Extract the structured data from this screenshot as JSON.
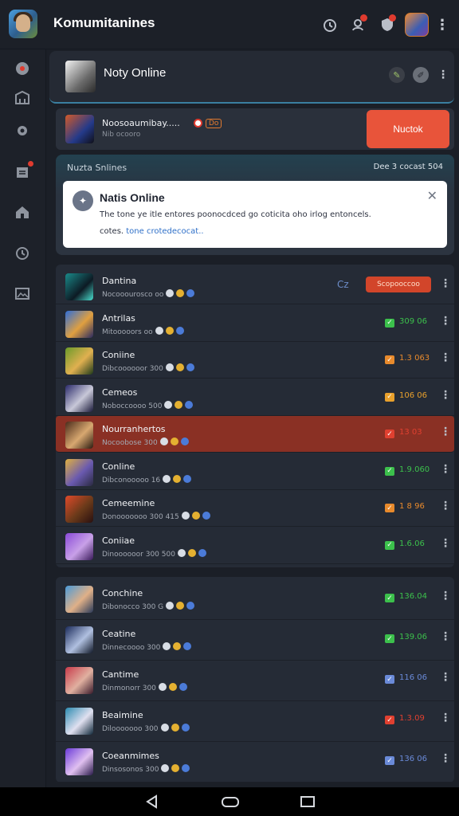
{
  "app": {
    "title": "Komumitanines"
  },
  "header": {
    "title": "Noty Online"
  },
  "request": {
    "name": "Noosoaumibay.....",
    "sub": "Nib ocooro",
    "chip": "Do",
    "button_label": "Nuctok"
  },
  "notice": {
    "section_label": "Nuzta Snlines",
    "date": "Dee 3 cocast 504",
    "title": "Natis Online",
    "body": "The tone ye itle entores poonocdced go coticita oho irlog entoncels.",
    "body2_prefix": "cotes.",
    "body2_link": "tone crotedecocat.."
  },
  "list1": [
    {
      "name": "Dantina",
      "sub": "Nocooourosco oo",
      "value": "",
      "badge": "Scopooccoo",
      "flag": "Cz",
      "status": "badge",
      "color": "#e03b2f"
    },
    {
      "name": "Antrilas",
      "sub": "Mitooooors oo",
      "value": "309 06",
      "status": "green",
      "color": "#3cc04c"
    },
    {
      "name": "Coniine",
      "sub": "Dibcoooooor 300",
      "value": "1.3 063",
      "status": "orange",
      "color": "#e88a2c"
    },
    {
      "name": "Cemeos",
      "sub": "Noboccoooo 500",
      "value": "106 06",
      "status": "orange",
      "color": "#e8a02c"
    },
    {
      "name": "Nourranhertos",
      "sub": "Nocoobose 300",
      "value": "13 03",
      "status": "red",
      "color": "#e04030",
      "highlight": true
    },
    {
      "name": "Conline",
      "sub": "Dibconooooo 16",
      "value": "1.9.060",
      "status": "green",
      "color": "#3cc04c"
    },
    {
      "name": "Cemeemine",
      "sub": "Donooooooo 300 415",
      "value": "1 8 96",
      "status": "orange",
      "color": "#e88a2c"
    },
    {
      "name": "Coniiae",
      "sub": "Dinoooooor 300 500",
      "value": "1.6.06",
      "status": "green",
      "color": "#3cc04c"
    }
  ],
  "list2": [
    {
      "name": "Conchine",
      "sub": "Dibonocco 300 G",
      "value": "136.04",
      "status": "green",
      "color": "#3cc04c"
    },
    {
      "name": "Ceatine",
      "sub": "Dinnecoooo 300",
      "value": "139.06",
      "status": "green",
      "color": "#3cc04c"
    },
    {
      "name": "Cantime",
      "sub": "Dinmonorr 300",
      "value": "116 06",
      "status": "blue",
      "color": "#6a8ad8"
    },
    {
      "name": "Beaimine",
      "sub": "Dilooooooo 300",
      "value": "1.3.09",
      "status": "red",
      "color": "#e04030"
    },
    {
      "name": "Coeanmimes",
      "sub": "Dinsosonos 300",
      "value": "136 06",
      "status": "blue",
      "color": "#6a8ad8"
    }
  ]
}
